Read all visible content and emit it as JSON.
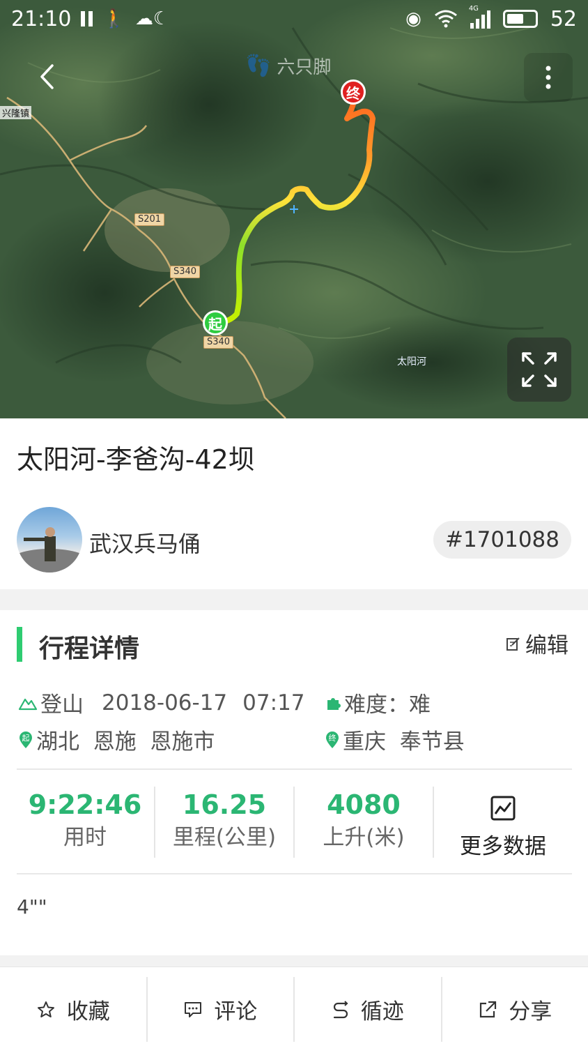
{
  "status_bar": {
    "time": "21:10",
    "network": "4G",
    "battery": "52"
  },
  "map": {
    "logo_text": "六只脚",
    "town_label": "兴隆镇",
    "road_labels": [
      "S201",
      "S340",
      "S340"
    ],
    "place_label": "太阳河",
    "start_pin": "起",
    "end_pin": "终"
  },
  "track": {
    "title": "太阳河-李爸沟-42坝",
    "username": "武汉兵马俑",
    "track_id": "#1701088"
  },
  "details": {
    "section_title": "行程详情",
    "edit_label": "编辑",
    "activity": "登山",
    "date": "2018-06-17",
    "time": "07:17",
    "difficulty": "难度：难",
    "start_location": "湖北  恩施  恩施市",
    "end_location": "重庆  奉节县",
    "start_badge": "起",
    "end_badge": "终"
  },
  "stats": [
    {
      "value": "9:22:46",
      "label": "用时"
    },
    {
      "value": "16.25",
      "label": "里程(公里)"
    },
    {
      "value": "4080",
      "label": "上升(米)"
    }
  ],
  "more_data_label": "更多数据",
  "description": "4\"\"",
  "bottom_bar": {
    "favorite": "收藏",
    "comment": "评论",
    "follow_track": "循迹",
    "share": "分享"
  },
  "colors": {
    "accent_green": "#2bb673",
    "section_bar": "#2ecc71",
    "start_pin": "#2ecc40",
    "end_pin": "#e02020"
  }
}
